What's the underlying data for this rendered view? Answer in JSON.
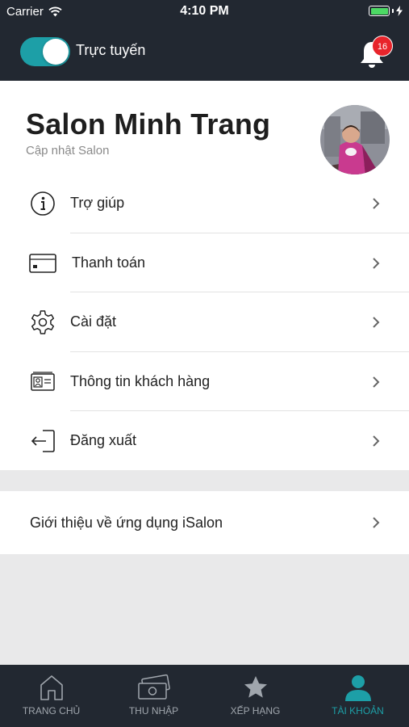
{
  "status_bar": {
    "carrier": "Carrier",
    "time": "4:10 PM"
  },
  "header": {
    "online_label": "Trực tuyến",
    "online_enabled": true,
    "notification_count": "16",
    "accent_color": "#1d9fa7",
    "badge_color": "#e8242b"
  },
  "profile": {
    "salon_name": "Salon Minh Trang",
    "update_link": "Cập nhật Salon"
  },
  "menu": {
    "items": [
      {
        "label": "Trợ giúp",
        "icon": "info-icon"
      },
      {
        "label": "Thanh toán",
        "icon": "credit-card-icon"
      },
      {
        "label": "Cài đặt",
        "icon": "gear-icon"
      },
      {
        "label": "Thông tin khách hàng",
        "icon": "contact-card-icon"
      },
      {
        "label": "Đăng xuất",
        "icon": "logout-icon"
      }
    ]
  },
  "about": {
    "label": "Giới thiệu về ứng dụng iSalon"
  },
  "tabbar": {
    "tabs": [
      {
        "label": "TRANG CHỦ",
        "icon": "home-icon",
        "active": false
      },
      {
        "label": "THU NHẬP",
        "icon": "money-icon",
        "active": false
      },
      {
        "label": "XẾP HẠNG",
        "icon": "star-icon",
        "active": false
      },
      {
        "label": "TÀI KHOẢN",
        "icon": "user-icon",
        "active": true
      }
    ]
  }
}
